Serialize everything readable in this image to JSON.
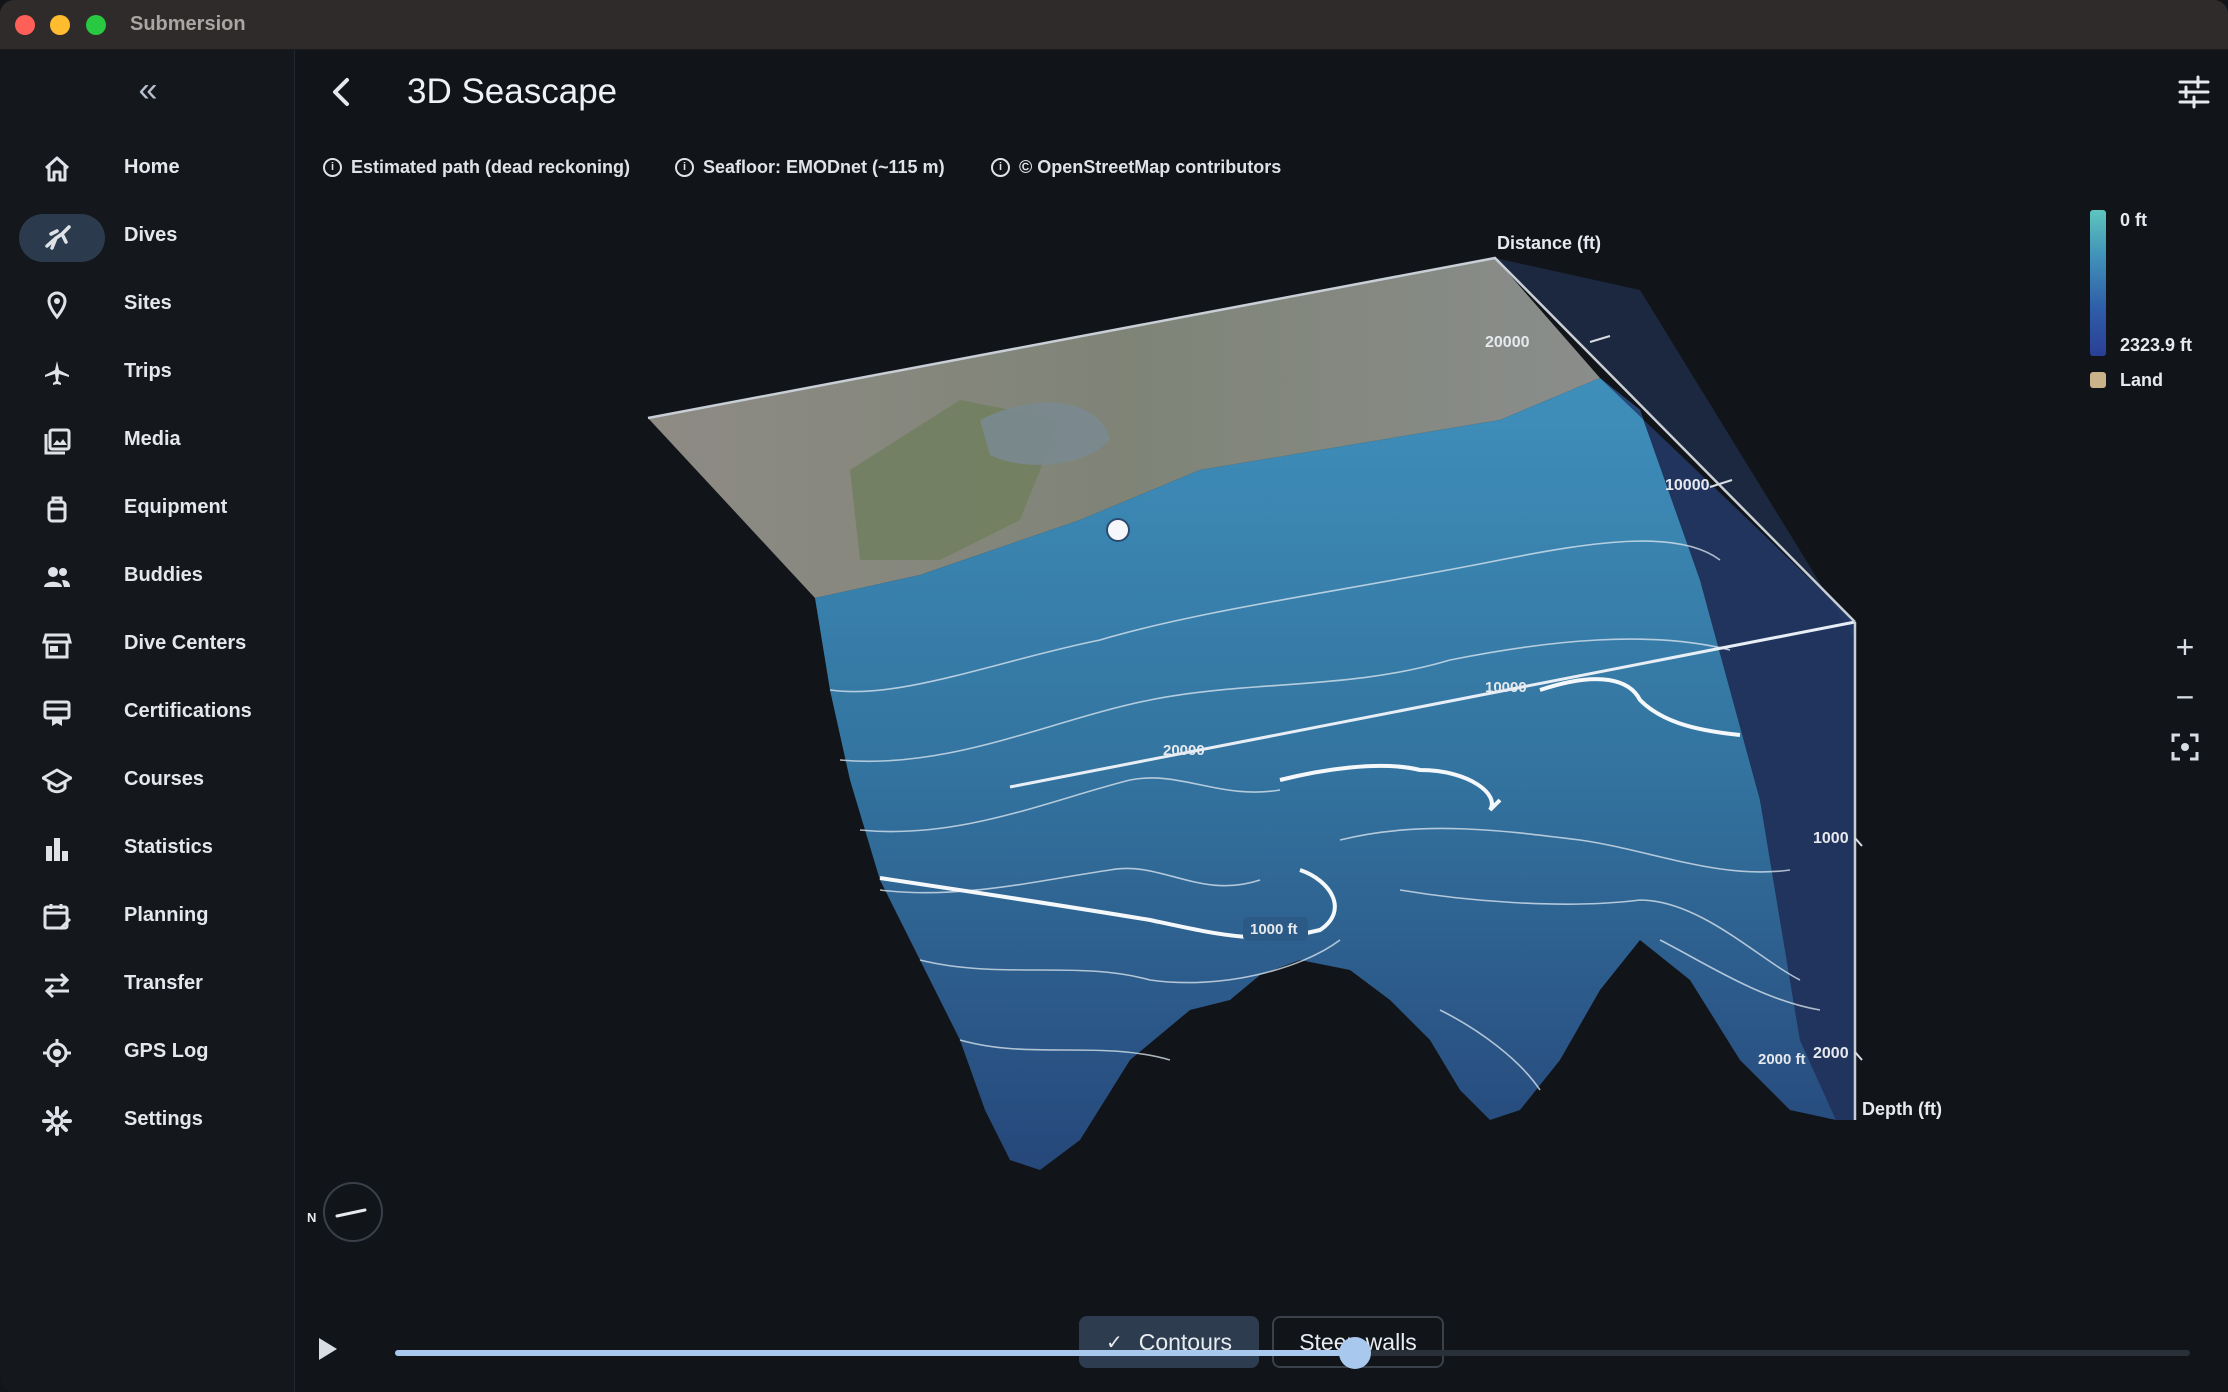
{
  "window": {
    "app_title": "Submersion"
  },
  "sidebar": {
    "collapse_icon": "double-chevron-left-icon",
    "items": [
      {
        "label": "Home",
        "icon": "home-icon",
        "active": false
      },
      {
        "label": "Dives",
        "icon": "scuba-diver-icon",
        "active": true
      },
      {
        "label": "Sites",
        "icon": "location-pin-icon",
        "active": false
      },
      {
        "label": "Trips",
        "icon": "airplane-icon",
        "active": false
      },
      {
        "label": "Media",
        "icon": "photo-library-icon",
        "active": false
      },
      {
        "label": "Equipment",
        "icon": "tank-icon",
        "active": false
      },
      {
        "label": "Buddies",
        "icon": "people-icon",
        "active": false
      },
      {
        "label": "Dive Centers",
        "icon": "storefront-icon",
        "active": false
      },
      {
        "label": "Certifications",
        "icon": "card-membership-icon",
        "active": false
      },
      {
        "label": "Courses",
        "icon": "school-icon",
        "active": false
      },
      {
        "label": "Statistics",
        "icon": "bar-chart-icon",
        "active": false
      },
      {
        "label": "Planning",
        "icon": "calendar-edit-icon",
        "active": false
      },
      {
        "label": "Transfer",
        "icon": "swap-arrows-icon",
        "active": false
      },
      {
        "label": "GPS Log",
        "icon": "gps-target-icon",
        "active": false
      },
      {
        "label": "Settings",
        "icon": "gear-icon",
        "active": false
      }
    ]
  },
  "header": {
    "title": "3D Seascape",
    "back_icon": "chevron-left-icon",
    "settings_icon": "tune-icon"
  },
  "attributions": [
    "Estimated path (dead reckoning)",
    "Seafloor: EMODnet (~115 m)",
    "© OpenStreetMap contributors"
  ],
  "scene": {
    "distance_axis_label": "Distance (ft)",
    "depth_axis_label": "Depth (ft)",
    "distance_ticks": [
      "20000",
      "10000"
    ],
    "floor_ticks": [
      "10000",
      "20000"
    ],
    "depth_ticks": [
      "1000",
      "2000"
    ],
    "contour_labels": [
      "1000 ft",
      "2000 ft"
    ]
  },
  "legend": {
    "top": "0 ft",
    "bottom": "2323.9 ft",
    "land": "Land",
    "colors": [
      "#5ec6be",
      "#2a3f96",
      "#c8b38a"
    ]
  },
  "zoom": {
    "in": "+",
    "out": "−"
  },
  "compass": {
    "label": "N"
  },
  "toggles": {
    "contours": "Contours",
    "steep_walls": "Steep walls"
  },
  "playback": {
    "progress": 0.535
  }
}
